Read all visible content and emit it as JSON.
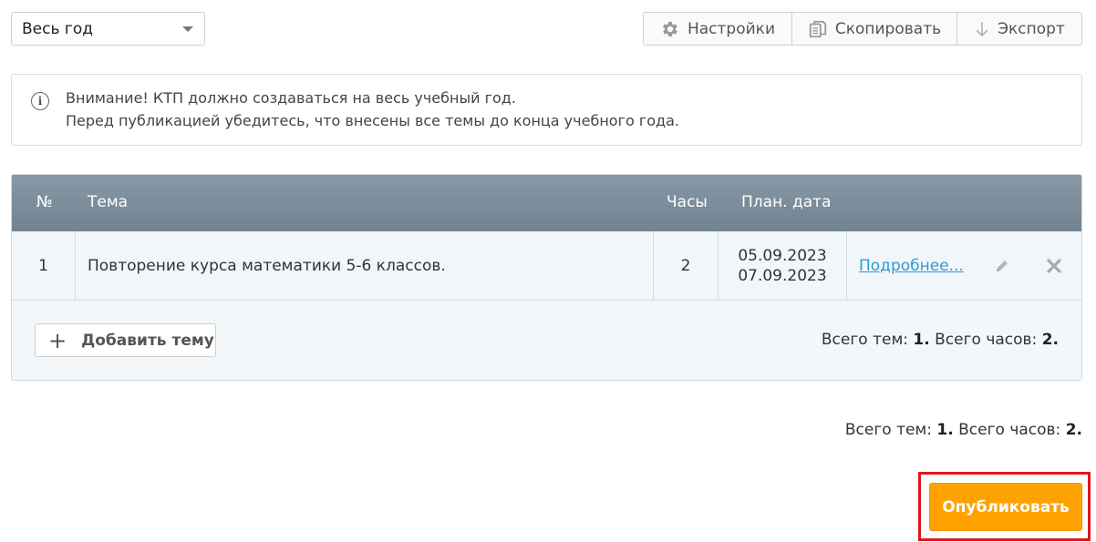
{
  "period_select": {
    "value": "Весь год"
  },
  "toolbar": {
    "settings_label": "Настройки",
    "copy_label": "Скопировать",
    "export_label": "Экспорт"
  },
  "notice": {
    "line1": "Внимание! КТП должно создаваться на весь учебный год.",
    "line2": "Перед публикацией убедитесь, что внесены все темы до конца учебного года."
  },
  "table": {
    "headers": {
      "num": "№",
      "topic": "Тема",
      "hours": "Часы",
      "date": "План. дата"
    },
    "rows": [
      {
        "num": "1",
        "topic": "Повторение курса математики 5-6 классов.",
        "hours": "2",
        "date_start": "05.09.2023",
        "date_end": "07.09.2023",
        "details_link": "Подробнее..."
      }
    ]
  },
  "add_topic_label": "Добавить тему",
  "totals": {
    "topics_label": "Всего тем:",
    "topics_value": "1.",
    "hours_label": "Всего часов:",
    "hours_value": "2."
  },
  "publish_label": "Опубликовать",
  "colors": {
    "accent": "#ffa200",
    "link": "#2f9bd6",
    "header": "#7b8d9a",
    "highlight": "#e0161e"
  }
}
